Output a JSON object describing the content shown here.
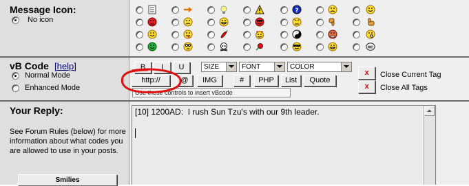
{
  "message_icon": {
    "title": "Message Icon:",
    "no_icon_label": "No icon",
    "icons": [
      [
        "notepad",
        "arrow-right",
        "lightbulb",
        "exclamation",
        "question",
        "frown",
        "smile"
      ],
      [
        "mad",
        "sad",
        "biggrin",
        "cool",
        "angry",
        "confused",
        "thumbs-up"
      ],
      [
        "wink",
        "tongue",
        "pepper",
        "devil",
        "yinyang",
        "grr",
        "eek"
      ],
      [
        "alien",
        "embarrassed",
        "skull",
        "rose",
        "shades",
        "cry",
        "thinking"
      ]
    ]
  },
  "vbcode": {
    "title": "vB Code",
    "help_label": "[help]",
    "normal_mode": "Normal Mode",
    "enhanced_mode": "Enhanced Mode",
    "buttons": {
      "bold": "B",
      "italic": "I",
      "underline": "U",
      "http": "http://",
      "email": "@",
      "img": "IMG",
      "hash": "#",
      "php": "PHP",
      "list": "List",
      "quote": "Quote"
    },
    "selects": {
      "size": "SIZE",
      "font": "FONT",
      "color": "COLOR"
    },
    "status_text": "Use these controls to insert vBcode",
    "close_current_tag": "Close Current Tag",
    "close_all_tags": "Close All Tags",
    "x_glyph": "x"
  },
  "reply": {
    "title": "Your Reply:",
    "help_text": "See Forum Rules (below) for more information about what codes you are allowed to use in your posts.",
    "textarea_value": "[10] 1200AD:  I rush Sun Tzu's with our 9th leader.",
    "smilies_label": "Smilies"
  },
  "colors": {
    "annotation_red": "#e01010"
  }
}
